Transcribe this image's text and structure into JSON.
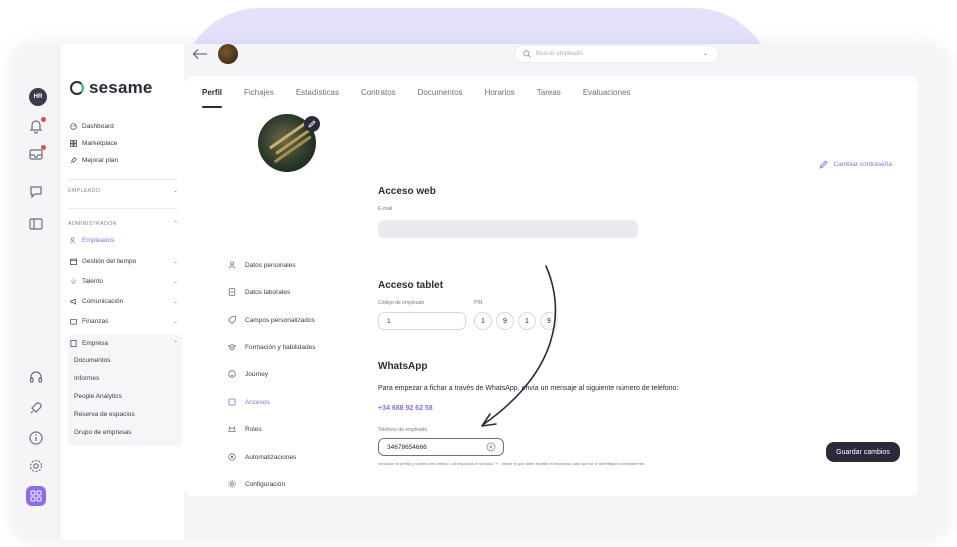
{
  "rail": {
    "avatar_initials": "HR"
  },
  "sidebar": {
    "brand": "sesame",
    "top_items": [
      {
        "label": "Dashboard",
        "icon": "dashboard-icon"
      },
      {
        "label": "Marketplace",
        "icon": "grid-icon"
      },
      {
        "label": "Mejorar plan",
        "icon": "rocket-icon"
      }
    ],
    "group_empleado": "EMPLEADO",
    "group_admin": "ADMINISTRADOR",
    "admin_items": [
      {
        "label": "Empleados",
        "active": true
      },
      {
        "label": "Gestión del tiempo"
      },
      {
        "label": "Talento"
      },
      {
        "label": "Comunicación"
      },
      {
        "label": "Finanzas"
      },
      {
        "label": "Empresa"
      }
    ],
    "empresa_sub": [
      "Documentos",
      "Informes",
      "People Analytics",
      "Reserva de espacios",
      "Grupo de empresas"
    ]
  },
  "topbar": {
    "search_placeholder": "Buscar empleado"
  },
  "tabs": [
    "Perfil",
    "Fichajes",
    "Estadísticas",
    "Contratos",
    "Documentos",
    "Horarios",
    "Tareas",
    "Evaluaciones"
  ],
  "profile_menu": [
    {
      "label": "Datos personales"
    },
    {
      "label": "Datos laborales"
    },
    {
      "label": "Campos personalizados"
    },
    {
      "label": "Formación y habilidades"
    },
    {
      "label": "Journey"
    },
    {
      "label": "Accesos",
      "active": true
    },
    {
      "label": "Roles"
    },
    {
      "label": "Automatizaciones"
    },
    {
      "label": "Configuración"
    }
  ],
  "web_access": {
    "title": "Acceso web",
    "email_label": "E-mail",
    "email_value": "",
    "change_password": "Cambiar contraseña"
  },
  "tablet_access": {
    "title": "Acceso tablet",
    "code_label": "Código de empleado",
    "code_value": "1",
    "pin_label": "PIN",
    "pin": [
      "1",
      "9",
      "1",
      "9"
    ]
  },
  "whatsapp": {
    "title": "WhatsApp",
    "intro": "Para empezar a fichar a través de WhatsApp, envía un mensaje al siguiente número de teléfono:",
    "number": "+34 688 92 62 58",
    "phone_label": "Teléfono de empleado",
    "phone_value": "34678654666",
    "help": "Introduce el prefijo y número de teléfono, sin espacios ni símbolo \"+\", desde el que debe escribir el empleado para que se le identifique correctamente."
  },
  "save_label": "Guardar cambios",
  "colors": {
    "accent": "#8a6cf0",
    "dark": "#2b2a3a",
    "notification": "#e5484d"
  }
}
